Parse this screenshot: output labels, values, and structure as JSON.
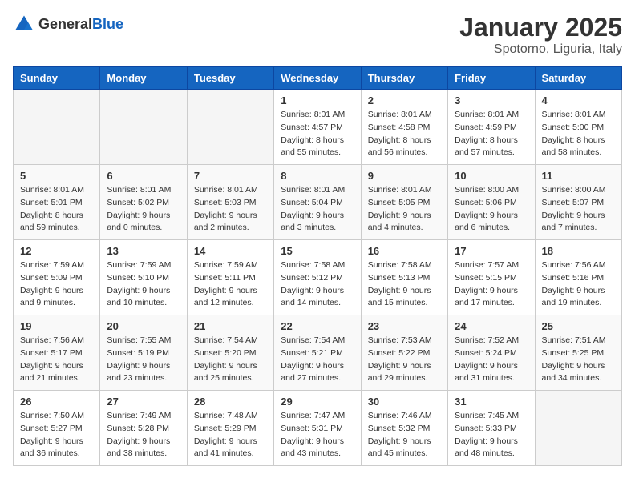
{
  "logo": {
    "text_general": "General",
    "text_blue": "Blue"
  },
  "header": {
    "title": "January 2025",
    "subtitle": "Spotorno, Liguria, Italy"
  },
  "weekdays": [
    "Sunday",
    "Monday",
    "Tuesday",
    "Wednesday",
    "Thursday",
    "Friday",
    "Saturday"
  ],
  "weeks": [
    [
      {
        "day": "",
        "info": ""
      },
      {
        "day": "",
        "info": ""
      },
      {
        "day": "",
        "info": ""
      },
      {
        "day": "1",
        "info": "Sunrise: 8:01 AM\nSunset: 4:57 PM\nDaylight: 8 hours\nand 55 minutes."
      },
      {
        "day": "2",
        "info": "Sunrise: 8:01 AM\nSunset: 4:58 PM\nDaylight: 8 hours\nand 56 minutes."
      },
      {
        "day": "3",
        "info": "Sunrise: 8:01 AM\nSunset: 4:59 PM\nDaylight: 8 hours\nand 57 minutes."
      },
      {
        "day": "4",
        "info": "Sunrise: 8:01 AM\nSunset: 5:00 PM\nDaylight: 8 hours\nand 58 minutes."
      }
    ],
    [
      {
        "day": "5",
        "info": "Sunrise: 8:01 AM\nSunset: 5:01 PM\nDaylight: 8 hours\nand 59 minutes."
      },
      {
        "day": "6",
        "info": "Sunrise: 8:01 AM\nSunset: 5:02 PM\nDaylight: 9 hours\nand 0 minutes."
      },
      {
        "day": "7",
        "info": "Sunrise: 8:01 AM\nSunset: 5:03 PM\nDaylight: 9 hours\nand 2 minutes."
      },
      {
        "day": "8",
        "info": "Sunrise: 8:01 AM\nSunset: 5:04 PM\nDaylight: 9 hours\nand 3 minutes."
      },
      {
        "day": "9",
        "info": "Sunrise: 8:01 AM\nSunset: 5:05 PM\nDaylight: 9 hours\nand 4 minutes."
      },
      {
        "day": "10",
        "info": "Sunrise: 8:00 AM\nSunset: 5:06 PM\nDaylight: 9 hours\nand 6 minutes."
      },
      {
        "day": "11",
        "info": "Sunrise: 8:00 AM\nSunset: 5:07 PM\nDaylight: 9 hours\nand 7 minutes."
      }
    ],
    [
      {
        "day": "12",
        "info": "Sunrise: 7:59 AM\nSunset: 5:09 PM\nDaylight: 9 hours\nand 9 minutes."
      },
      {
        "day": "13",
        "info": "Sunrise: 7:59 AM\nSunset: 5:10 PM\nDaylight: 9 hours\nand 10 minutes."
      },
      {
        "day": "14",
        "info": "Sunrise: 7:59 AM\nSunset: 5:11 PM\nDaylight: 9 hours\nand 12 minutes."
      },
      {
        "day": "15",
        "info": "Sunrise: 7:58 AM\nSunset: 5:12 PM\nDaylight: 9 hours\nand 14 minutes."
      },
      {
        "day": "16",
        "info": "Sunrise: 7:58 AM\nSunset: 5:13 PM\nDaylight: 9 hours\nand 15 minutes."
      },
      {
        "day": "17",
        "info": "Sunrise: 7:57 AM\nSunset: 5:15 PM\nDaylight: 9 hours\nand 17 minutes."
      },
      {
        "day": "18",
        "info": "Sunrise: 7:56 AM\nSunset: 5:16 PM\nDaylight: 9 hours\nand 19 minutes."
      }
    ],
    [
      {
        "day": "19",
        "info": "Sunrise: 7:56 AM\nSunset: 5:17 PM\nDaylight: 9 hours\nand 21 minutes."
      },
      {
        "day": "20",
        "info": "Sunrise: 7:55 AM\nSunset: 5:19 PM\nDaylight: 9 hours\nand 23 minutes."
      },
      {
        "day": "21",
        "info": "Sunrise: 7:54 AM\nSunset: 5:20 PM\nDaylight: 9 hours\nand 25 minutes."
      },
      {
        "day": "22",
        "info": "Sunrise: 7:54 AM\nSunset: 5:21 PM\nDaylight: 9 hours\nand 27 minutes."
      },
      {
        "day": "23",
        "info": "Sunrise: 7:53 AM\nSunset: 5:22 PM\nDaylight: 9 hours\nand 29 minutes."
      },
      {
        "day": "24",
        "info": "Sunrise: 7:52 AM\nSunset: 5:24 PM\nDaylight: 9 hours\nand 31 minutes."
      },
      {
        "day": "25",
        "info": "Sunrise: 7:51 AM\nSunset: 5:25 PM\nDaylight: 9 hours\nand 34 minutes."
      }
    ],
    [
      {
        "day": "26",
        "info": "Sunrise: 7:50 AM\nSunset: 5:27 PM\nDaylight: 9 hours\nand 36 minutes."
      },
      {
        "day": "27",
        "info": "Sunrise: 7:49 AM\nSunset: 5:28 PM\nDaylight: 9 hours\nand 38 minutes."
      },
      {
        "day": "28",
        "info": "Sunrise: 7:48 AM\nSunset: 5:29 PM\nDaylight: 9 hours\nand 41 minutes."
      },
      {
        "day": "29",
        "info": "Sunrise: 7:47 AM\nSunset: 5:31 PM\nDaylight: 9 hours\nand 43 minutes."
      },
      {
        "day": "30",
        "info": "Sunrise: 7:46 AM\nSunset: 5:32 PM\nDaylight: 9 hours\nand 45 minutes."
      },
      {
        "day": "31",
        "info": "Sunrise: 7:45 AM\nSunset: 5:33 PM\nDaylight: 9 hours\nand 48 minutes."
      },
      {
        "day": "",
        "info": ""
      }
    ]
  ]
}
